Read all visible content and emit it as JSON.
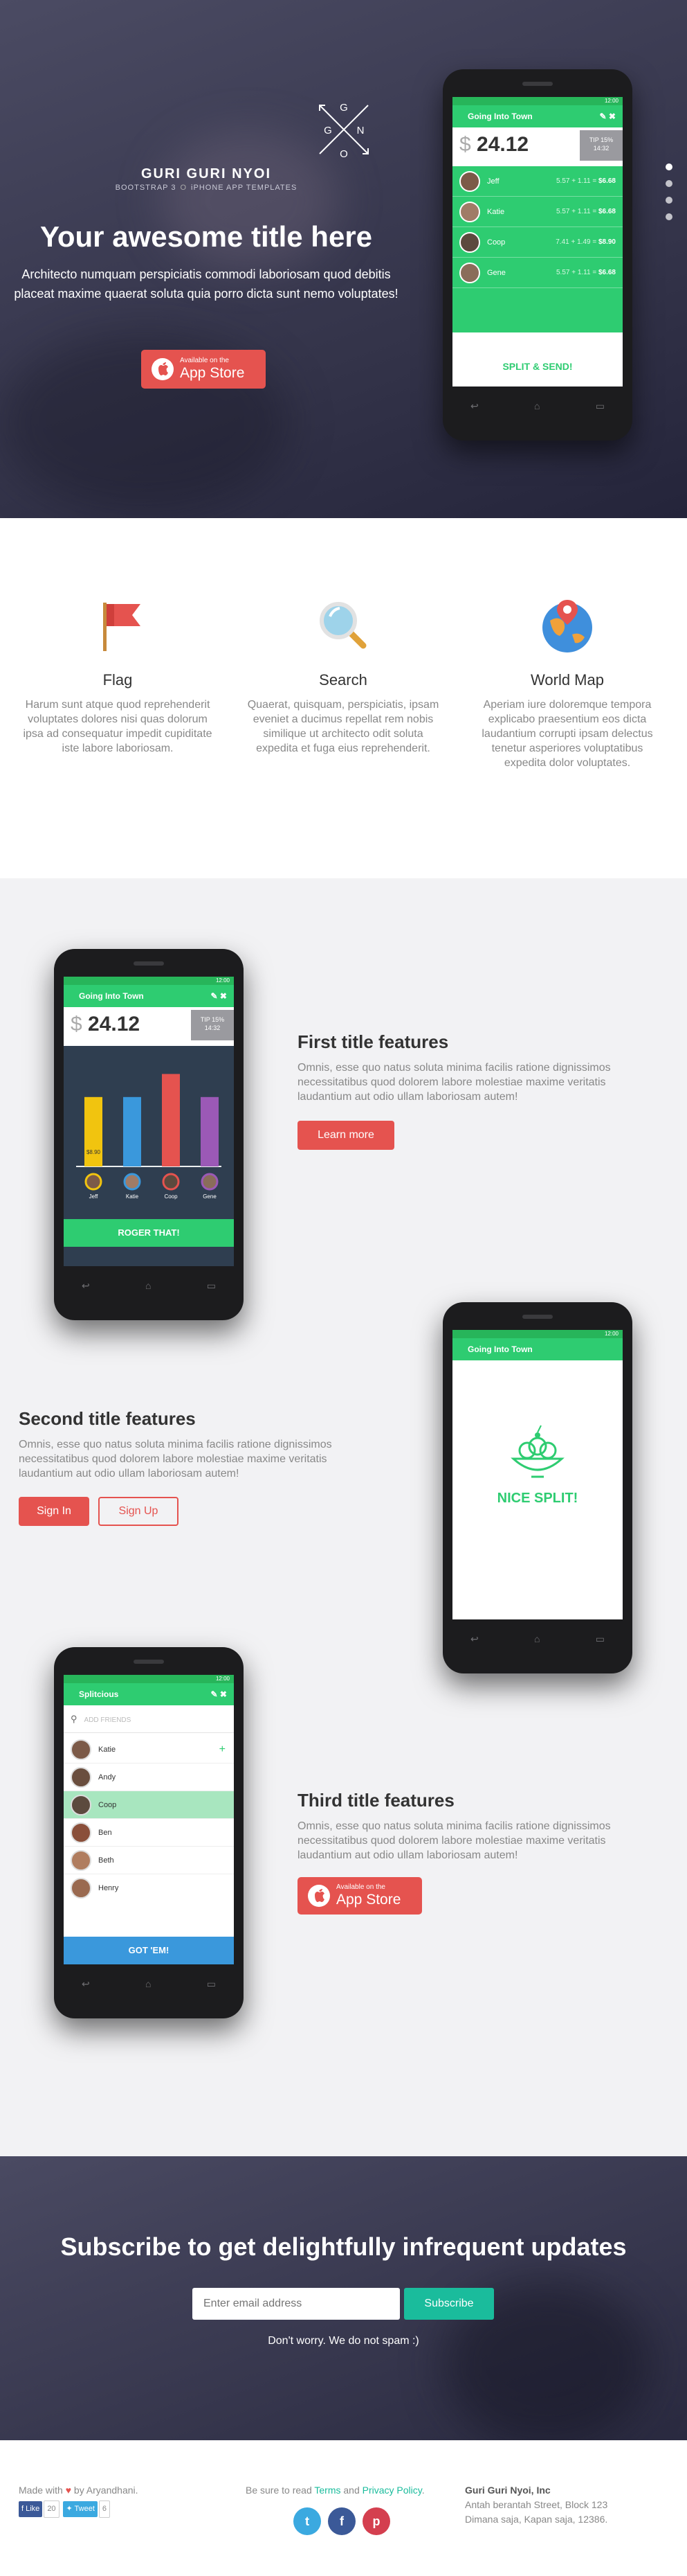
{
  "hero": {
    "logo_letters": [
      "G",
      "G",
      "N",
      "O"
    ],
    "brand_name": "GURI GURI NYOI",
    "brand_sub_left": "BOOTSTRAP 3",
    "brand_sub_sep": "O",
    "brand_sub_right": "iPHONE APP TEMPLATES",
    "title": "Your awesome title here",
    "text": "Architecto numquam perspiciatis commodi laboriosam quod debitis placeat maxime quaerat soluta quia porro dicta sunt nemo voluptates!",
    "store_small": "Available on the",
    "store_large": "App Store",
    "pager_count": 4
  },
  "phone_app": {
    "time": "12:00",
    "title": "Going Into Town",
    "currency": "$",
    "amount": "24.12",
    "tag_top": "TIP 15%",
    "tag_bottom": "14:32",
    "people": [
      {
        "name": "Jeff",
        "calc": "5.57 + 1.11 = ",
        "total": "$6.68"
      },
      {
        "name": "Katie",
        "calc": "5.57 + 1.11 = ",
        "total": "$6.68"
      },
      {
        "name": "Coop",
        "calc": "7.41 + 1.49 = ",
        "total": "$8.90"
      },
      {
        "name": "Gene",
        "calc": "5.57 + 1.11 = ",
        "total": "$6.68"
      }
    ],
    "split_label": "SPLIT & SEND!",
    "roger_label": "ROGER THAT!",
    "nice_split": "NICE SPLIT!",
    "splitcious_title": "Splitcious",
    "add_friends": "ADD FRIENDS",
    "friends": [
      "Katie",
      "Andy",
      "Coop",
      "Ben",
      "Beth",
      "Henry"
    ],
    "got_em": "GOT 'EM!",
    "bar_tip": "$8.90"
  },
  "chart_data": {
    "type": "bar",
    "categories": [
      "Jeff",
      "Katie",
      "Coop",
      "Gene"
    ],
    "values": [
      6.68,
      6.68,
      8.9,
      6.68
    ],
    "ylim": [
      0,
      10
    ]
  },
  "features": [
    {
      "title": "Flag",
      "text": "Harum sunt atque quod reprehenderit voluptates dolores nisi quas dolorum ipsa ad consequatur impedit cupiditate iste labore laboriosam."
    },
    {
      "title": "Search",
      "text": "Quaerat, quisquam, perspiciatis, ipsam eveniet a ducimus repellat rem nobis similique ut architecto odit soluta expedita et fuga eius reprehenderit."
    },
    {
      "title": "World Map",
      "text": "Aperiam iure doloremque tempora explicabo praesentium eos dicta laudantium corrupti ipsam delectus tenetur asperiores voluptatibus expedita dolor voluptates."
    }
  ],
  "showcase": {
    "f1_title": "First title features",
    "f1_text": "Omnis, esse quo natus soluta minima facilis ratione dignissimos necessitatibus quod dolorem labore molestiae maxime veritatis laudantium aut odio ullam laboriosam autem!",
    "f1_btn": "Learn more",
    "f2_title": "Second title features",
    "f2_text": "Omnis, esse quo natus soluta minima facilis ratione dignissimos necessitatibus quod dolorem labore molestiae maxime veritatis laudantium aut odio ullam laboriosam autem!",
    "f2_btn_signin": "Sign In",
    "f2_btn_signup": "Sign Up",
    "f3_title": "Third title features",
    "f3_text": "Omnis, esse quo natus soluta minima facilis ratione dignissimos necessitatibus quod dolorem labore molestiae maxime veritatis laudantium aut odio ullam laboriosam autem!"
  },
  "subscribe": {
    "title": "Subscribe to get delightfully infrequent updates",
    "placeholder": "Enter email address",
    "button": "Subscribe",
    "note": "Don't worry. We do not spam :)"
  },
  "footer": {
    "made_with": "Made with",
    "by": "by Aryandhani.",
    "like": "Like",
    "like_count": "20",
    "tweet": "Tweet",
    "tweet_count": "6",
    "read_prefix": "Be sure to read",
    "terms": "Terms",
    "and": "and",
    "privacy": "Privacy Policy",
    "company": "Guri Guri Nyoi, Inc",
    "address1": "Antah berantah Street, Block 123",
    "address2": "Dimana saja, Kapan saja, 12386.",
    "colors": {
      "twitter": "#3ba9e0",
      "facebook": "#3b5998",
      "pinterest": "#d43f4f"
    }
  }
}
